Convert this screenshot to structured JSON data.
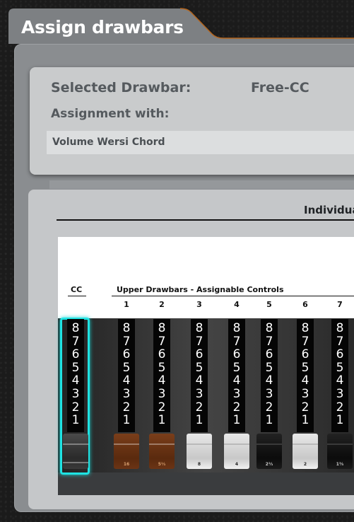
{
  "window": {
    "title": "Assign drawbars"
  },
  "selection": {
    "selected_label": "Selected Drawbar:",
    "selected_value": "Free-CC",
    "assignment_label": "Assignment with:",
    "assignment_value": "Volume Wersi Chord"
  },
  "individual": {
    "label": "Individua"
  },
  "drawbar_panel": {
    "cc_header": "CC",
    "upper_header": "Upper Drawbars - Assignable Controls",
    "columns": [
      "1",
      "2",
      "3",
      "4",
      "5",
      "6",
      "7"
    ],
    "scale": [
      "8",
      "7",
      "6",
      "5",
      "4",
      "3",
      "2",
      "1"
    ],
    "cc_drawbar": {
      "color": "dark-gray",
      "highlight": "#1fe3e3",
      "selected": true
    },
    "drawbars": [
      {
        "number": "1",
        "footage": "16",
        "color": "brown"
      },
      {
        "number": "2",
        "footage": "5⅓",
        "color": "brown"
      },
      {
        "number": "3",
        "footage": "8",
        "color": "white"
      },
      {
        "number": "4",
        "footage": "4",
        "color": "white"
      },
      {
        "number": "5",
        "footage": "2⅔",
        "color": "black"
      },
      {
        "number": "6",
        "footage": "2",
        "color": "white"
      },
      {
        "number": "7",
        "footage": "1⅗",
        "color": "black"
      }
    ]
  },
  "colors": {
    "accent": "#1fe3e3",
    "brown_drawbar": "#6b3415",
    "title_tab": "#7d8083"
  }
}
